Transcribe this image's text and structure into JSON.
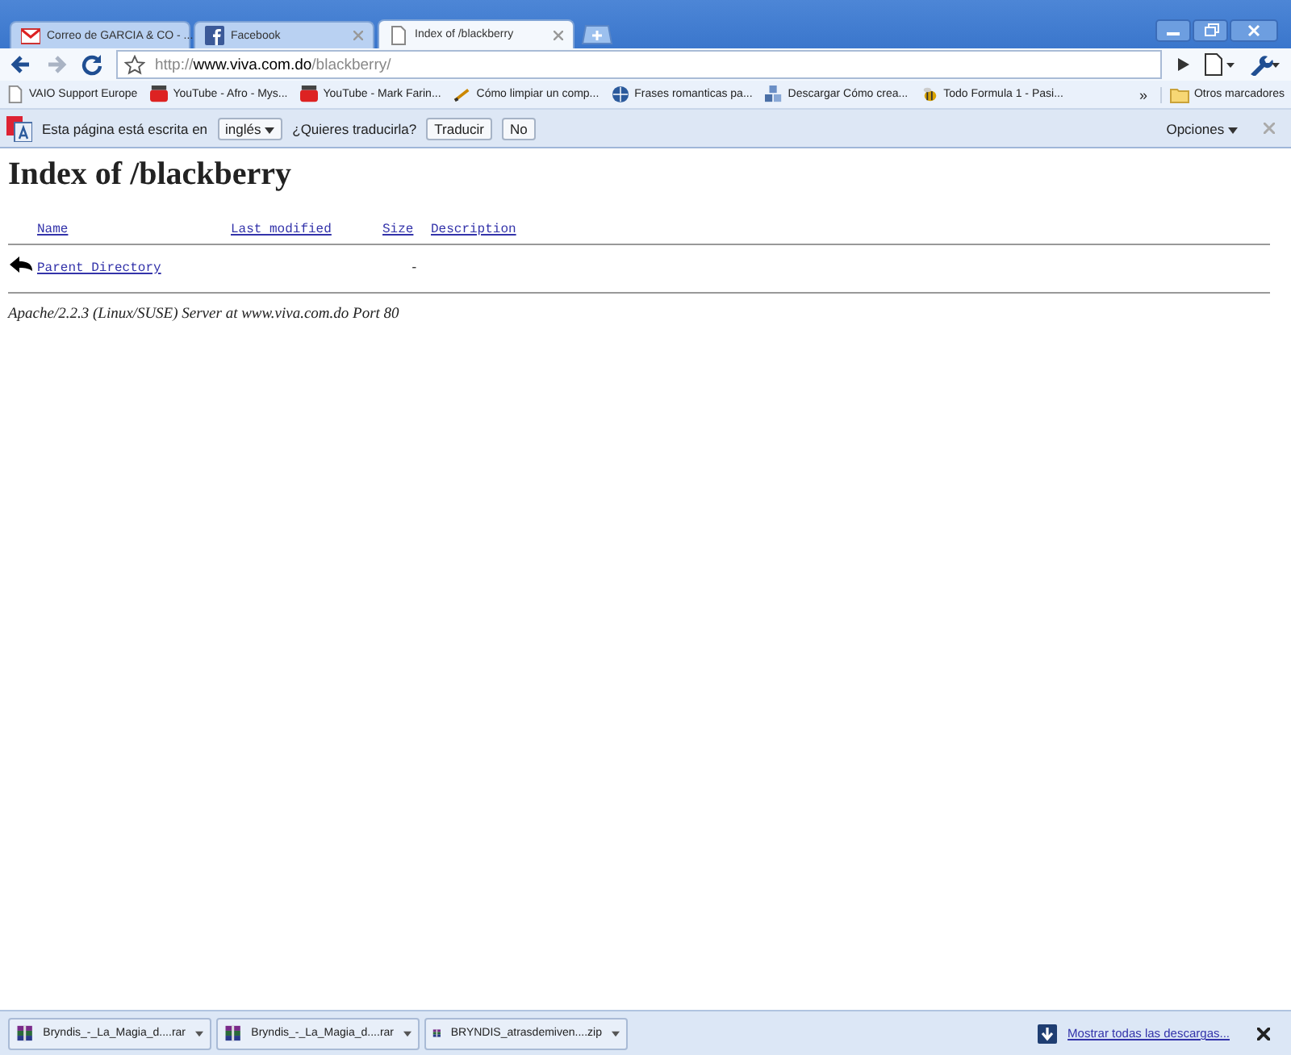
{
  "tabs": [
    {
      "title": "Correo de GARCIA & CO - ...",
      "selected": false
    },
    {
      "title": "Facebook",
      "selected": false
    },
    {
      "title": "Index of /blackberry",
      "selected": true
    }
  ],
  "address": {
    "scheme": "http://",
    "host": "www.viva.com.do",
    "path": "/blackberry/"
  },
  "bookmarks": [
    {
      "title": "VAIO Support Europe"
    },
    {
      "title": "YouTube - Afro - Mys..."
    },
    {
      "title": "YouTube - Mark Farin..."
    },
    {
      "title": "Cómo limpiar un comp..."
    },
    {
      "title": "Frases romanticas pa..."
    },
    {
      "title": "Descargar Cómo crea..."
    },
    {
      "title": "Todo Formula 1 - Pasi..."
    }
  ],
  "bookmarks_overflow": "»",
  "other_bookmarks": "Otros marcadores",
  "translate_bar": {
    "prefix": "Esta página está escrita en",
    "language": "inglés",
    "question": "¿Quieres traducirla?",
    "translate": "Traducir",
    "no": "No",
    "options": "Opciones"
  },
  "page": {
    "heading": "Index of /blackberry",
    "columns": [
      "Name",
      "Last modified",
      "Size",
      "Description"
    ],
    "rows": [
      {
        "name": "Parent Directory",
        "size": "-"
      }
    ],
    "footer": "Apache/2.2.3 (Linux/SUSE) Server at www.viva.com.do Port 80"
  },
  "downloads": [
    {
      "file": "Bryndis_-_La_Magia_d....rar"
    },
    {
      "file": "Bryndis_-_La_Magia_d....rar"
    },
    {
      "file": "BRYNDIS_atrasdemiven....zip"
    }
  ],
  "show_all_downloads": "Mostrar todas las descargas..."
}
